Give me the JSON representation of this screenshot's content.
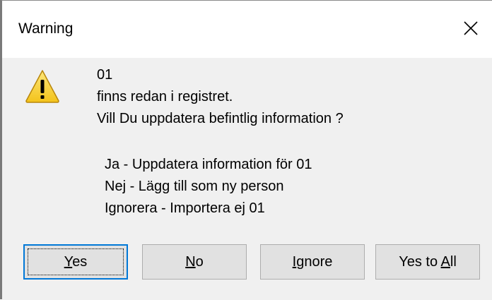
{
  "window": {
    "title": "Warning",
    "close_glyph": "✕"
  },
  "icon": {
    "type": "warning-icon",
    "colors": {
      "fill": "#f7d12e",
      "outline": "#b8860b",
      "mark": "#000000"
    }
  },
  "message": {
    "line1": "01",
    "line2": "finns redan i registret.",
    "line3": "Vill Du uppdatera befintlig information ?",
    "option1": "Ja - Uppdatera information för 01",
    "option2": "Nej - Lägg till som ny person",
    "option3": "Ignorera - Importera ej 01"
  },
  "buttons": {
    "yes": {
      "accel": "Y",
      "rest": "es"
    },
    "no": {
      "accel": "N",
      "rest": "o"
    },
    "ignore": {
      "accel": "I",
      "rest": "gnore"
    },
    "yes_to_all": {
      "pre": "Yes to ",
      "accel": "A",
      "rest": "ll"
    }
  },
  "colors": {
    "dialog_bg": "#f0f0f0",
    "titlebar_bg": "#ffffff",
    "button_bg": "#e1e1e1",
    "default_border": "#0078d7"
  }
}
